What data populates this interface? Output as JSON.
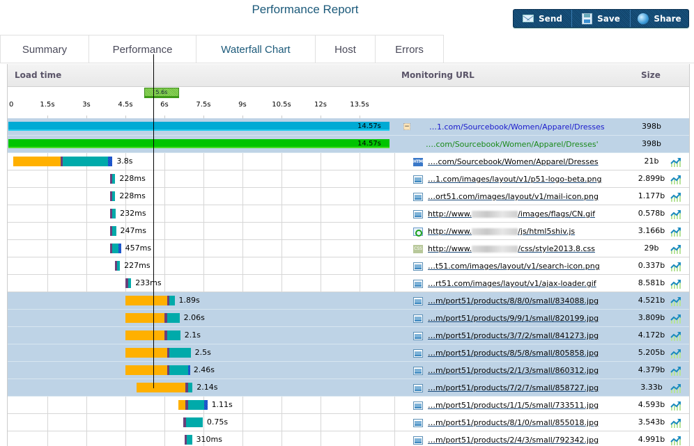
{
  "header": {
    "title": "Performance Report"
  },
  "actions": [
    {
      "label": "Send",
      "icon": "mail-icon"
    },
    {
      "label": "Save",
      "icon": "save-icon"
    },
    {
      "label": "Share",
      "icon": "globe-icon"
    }
  ],
  "tabs": [
    {
      "label": "Summary",
      "active": false
    },
    {
      "label": "Performance",
      "active": false
    },
    {
      "label": "Waterfall Chart",
      "active": true
    },
    {
      "label": "Host",
      "active": false
    },
    {
      "label": "Errors",
      "active": false
    }
  ],
  "table": {
    "columns": {
      "load_time": "Load time",
      "url": "Monitoring URL",
      "size": "Size"
    }
  },
  "colors": {
    "wait": "#ffb000",
    "connect": "#6b3f7a",
    "receive": "#00aaaa",
    "download": "#2040c0",
    "total_blue": "#00aad4",
    "total_green": "#00c400",
    "selected_row": "#bed3e6"
  },
  "chart_data": {
    "type": "waterfall",
    "axis": {
      "unit": "s",
      "min": 0,
      "max": 14.57,
      "ticks": [
        "0",
        "1.5s",
        "3s",
        "4.5s",
        "6s",
        "7.5s",
        "9s",
        "10.5s",
        "12s",
        "13.5s"
      ],
      "tick_values": [
        0,
        1.5,
        3,
        4.5,
        6,
        7.5,
        9,
        10.5,
        12,
        13.5
      ]
    },
    "marker": {
      "label": "5.6s",
      "value": 5.6
    },
    "summary_rows": [
      {
        "duration": "14.57s",
        "start": 0,
        "total": 14.57,
        "url": "…1.com/Sourcebook/Women/Apparel/Dresses",
        "size": "398b",
        "color": "blue",
        "collapse_label": "−"
      },
      {
        "duration": "14.57s",
        "start": 0,
        "total": 14.57,
        "url": "….com/Sourcebook/Women/Apparel/Dresses'",
        "size": "398b",
        "color": "green"
      }
    ],
    "rows": [
      {
        "type": "html",
        "url": "….com/Sourcebook/Women/Apparel/Dresses",
        "size": "21b",
        "duration": "3.8s",
        "selected": false,
        "segments": [
          {
            "k": "wait",
            "s": 0.2,
            "e": 2.0
          },
          {
            "k": "conn",
            "s": 2.0,
            "e": 2.1
          },
          {
            "k": "recv",
            "s": 2.1,
            "e": 3.83
          },
          {
            "k": "dl",
            "s": 3.83,
            "e": 4.0
          }
        ]
      },
      {
        "type": "img",
        "url": "…1.com/images/layout/v1/p51-logo-beta.png",
        "size": "2.899b",
        "duration": "228ms",
        "selected": false,
        "segments": [
          {
            "k": "conn",
            "s": 3.9,
            "e": 4.0
          },
          {
            "k": "recv",
            "s": 4.0,
            "e": 4.11
          }
        ]
      },
      {
        "type": "img",
        "url": "…ort51.com/images/layout/v1/mail-icon.png",
        "size": "1.177b",
        "duration": "228ms",
        "selected": false,
        "segments": [
          {
            "k": "conn",
            "s": 3.9,
            "e": 4.0
          },
          {
            "k": "recv",
            "s": 4.0,
            "e": 4.11
          }
        ]
      },
      {
        "type": "img",
        "url_prefix": "http://www.",
        "url_blurred": true,
        "url_suffix": "/images/flags/CN.gif",
        "size": "0.578b",
        "duration": "232ms",
        "selected": false,
        "segments": [
          {
            "k": "conn",
            "s": 3.9,
            "e": 4.0
          },
          {
            "k": "recv",
            "s": 4.0,
            "e": 4.13
          }
        ]
      },
      {
        "type": "js",
        "url_prefix": "http://www.",
        "url_blurred": true,
        "url_suffix": "/js/html5shiv.js",
        "size": "3.166b",
        "duration": "247ms",
        "selected": false,
        "segments": [
          {
            "k": "conn",
            "s": 3.9,
            "e": 4.0
          },
          {
            "k": "recv",
            "s": 4.0,
            "e": 4.14
          }
        ]
      },
      {
        "type": "css",
        "url_prefix": "http://www.",
        "url_blurred": true,
        "url_suffix": "/css/style2013.8.css",
        "size": "29b",
        "duration": "457ms",
        "selected": false,
        "segments": [
          {
            "k": "conn",
            "s": 3.9,
            "e": 4.0
          },
          {
            "k": "recv",
            "s": 4.0,
            "e": 4.24
          },
          {
            "k": "dl",
            "s": 4.24,
            "e": 4.33
          }
        ]
      },
      {
        "type": "img",
        "url": "…t51.com/images/layout/v1/search-icon.png",
        "size": "0.337b",
        "duration": "227ms",
        "selected": false,
        "segments": [
          {
            "k": "conn",
            "s": 4.09,
            "e": 4.19
          },
          {
            "k": "recv",
            "s": 4.19,
            "e": 4.29
          }
        ]
      },
      {
        "type": "img",
        "url": "…rt51.com/images/layout/v1/ajax-loader.gif",
        "size": "8.581b",
        "duration": "233ms",
        "selected": false,
        "segments": [
          {
            "k": "conn",
            "s": 4.5,
            "e": 4.61
          },
          {
            "k": "recv",
            "s": 4.61,
            "e": 4.72
          }
        ]
      },
      {
        "type": "img",
        "url": "…m/port51/products/8/8/0/small/834088.jpg",
        "size": "4.521b",
        "duration": "1.89s",
        "selected": true,
        "segments": [
          {
            "k": "wait",
            "s": 4.5,
            "e": 6.1
          },
          {
            "k": "conn",
            "s": 6.1,
            "e": 6.2
          },
          {
            "k": "recv",
            "s": 6.2,
            "e": 6.39
          }
        ]
      },
      {
        "type": "img",
        "url": "…m/port51/products/9/9/1/small/820199.jpg",
        "size": "3.809b",
        "duration": "2.06s",
        "selected": true,
        "segments": [
          {
            "k": "wait",
            "s": 4.5,
            "e": 6.0
          },
          {
            "k": "conn",
            "s": 6.0,
            "e": 6.1
          },
          {
            "k": "recv",
            "s": 6.1,
            "e": 6.58
          }
        ]
      },
      {
        "type": "img",
        "url": "…m/port51/products/3/7/2/small/841273.jpg",
        "size": "4.172b",
        "duration": "2.1s",
        "selected": true,
        "segments": [
          {
            "k": "wait",
            "s": 4.5,
            "e": 6.0
          },
          {
            "k": "conn",
            "s": 6.0,
            "e": 6.1
          },
          {
            "k": "recv",
            "s": 6.1,
            "e": 6.61
          }
        ]
      },
      {
        "type": "img",
        "url": "…m/port51/products/8/5/8/small/805858.jpg",
        "size": "5.205b",
        "duration": "2.5s",
        "selected": true,
        "segments": [
          {
            "k": "wait",
            "s": 4.5,
            "e": 6.1
          },
          {
            "k": "conn",
            "s": 6.1,
            "e": 6.2
          },
          {
            "k": "recv",
            "s": 6.2,
            "e": 7.01
          }
        ]
      },
      {
        "type": "img",
        "url": "…m/port51/products/2/1/3/small/860312.jpg",
        "size": "4.379b",
        "duration": "2.46s",
        "selected": true,
        "segments": [
          {
            "k": "wait",
            "s": 4.5,
            "e": 6.1
          },
          {
            "k": "conn",
            "s": 6.1,
            "e": 6.2
          },
          {
            "k": "recv",
            "s": 6.2,
            "e": 6.9
          },
          {
            "k": "dl",
            "s": 6.9,
            "e": 6.96
          }
        ]
      },
      {
        "type": "img",
        "url": "…m/port51/products/7/2/7/small/858727.jpg",
        "size": "3.33b",
        "duration": "2.14s",
        "selected": true,
        "segments": [
          {
            "k": "wait",
            "s": 4.93,
            "e": 6.8
          },
          {
            "k": "conn",
            "s": 6.8,
            "e": 6.9
          },
          {
            "k": "recv",
            "s": 6.9,
            "e": 7.08
          }
        ]
      },
      {
        "type": "img",
        "url": "…m/port51/products/1/1/5/small/733511.jpg",
        "size": "4.593b",
        "duration": "1.11s",
        "selected": false,
        "segments": [
          {
            "k": "wait",
            "s": 6.54,
            "e": 6.8
          },
          {
            "k": "conn",
            "s": 6.8,
            "e": 6.9
          },
          {
            "k": "recv",
            "s": 6.9,
            "e": 7.53
          },
          {
            "k": "dl",
            "s": 7.53,
            "e": 7.65
          }
        ]
      },
      {
        "type": "img",
        "url": "…m/port51/products/8/1/0/small/855018.jpg",
        "size": "3.543b",
        "duration": "0.75s",
        "selected": false,
        "segments": [
          {
            "k": "conn",
            "s": 6.72,
            "e": 6.82
          },
          {
            "k": "recv",
            "s": 6.82,
            "e": 7.47
          }
        ]
      },
      {
        "type": "img",
        "url": "…m/port51/products/2/4/3/small/792342.jpg",
        "size": "4.991b",
        "duration": "310ms",
        "selected": false,
        "segments": [
          {
            "k": "conn",
            "s": 6.77,
            "e": 6.87
          },
          {
            "k": "recv",
            "s": 6.87,
            "e": 7.06
          }
        ]
      }
    ]
  }
}
